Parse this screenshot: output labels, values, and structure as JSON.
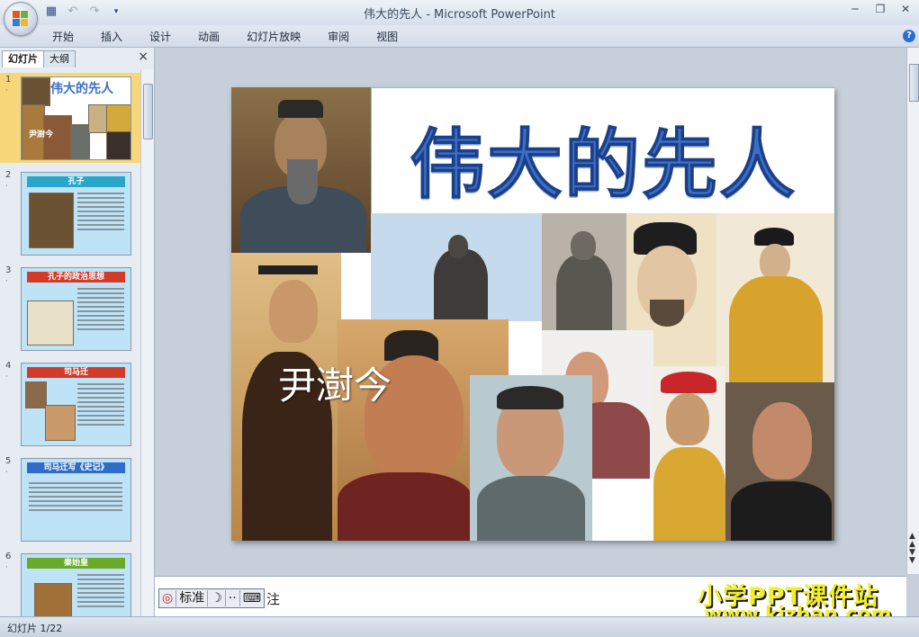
{
  "window": {
    "title": "伟大的先人 - Microsoft PowerPoint"
  },
  "quick_access": [
    "save-icon",
    "undo-icon",
    "redo-icon",
    "customize-icon"
  ],
  "ribbon": {
    "tabs": [
      "开始",
      "插入",
      "设计",
      "动画",
      "幻灯片放映",
      "审阅",
      "视图"
    ]
  },
  "left_pane": {
    "tabs": [
      "幻灯片",
      "大纲"
    ],
    "close_label": "×",
    "slides": [
      {
        "num": "1",
        "title": "伟大的先人",
        "author": "尹澍今",
        "selected": true
      },
      {
        "num": "2",
        "title": "孔子"
      },
      {
        "num": "3",
        "title": "孔子的政治思想"
      },
      {
        "num": "4",
        "title": "司马迁"
      },
      {
        "num": "5",
        "title": "司马迁写《史记》"
      },
      {
        "num": "6",
        "title": "秦始皇"
      }
    ]
  },
  "slide": {
    "title": "伟大的先人",
    "author": "尹澍今"
  },
  "notes": {
    "text": "注"
  },
  "ime": {
    "mode": "标准"
  },
  "status": {
    "slide_counter": "幻灯片 1/22"
  },
  "watermark": {
    "line1": "小学PPT课件站",
    "line2": "www.kjzhan.com"
  },
  "colors": {
    "title_blue": "#3a6fc9",
    "ribbon": "#d3dce8",
    "selected_thumb": "#f8d67a",
    "watermark": "#f2ee2a"
  }
}
